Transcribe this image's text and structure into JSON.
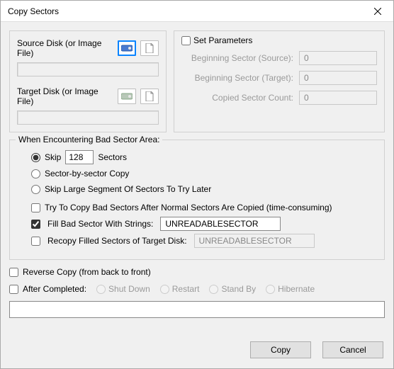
{
  "title": "Copy Sectors",
  "left": {
    "source_label": "Source Disk (or Image File)",
    "target_label": "Target Disk (or Image File)"
  },
  "params": {
    "set_label": "Set Parameters",
    "beg_src_label": "Beginning Sector (Source):",
    "beg_src_value": "0",
    "beg_tgt_label": "Beginning Sector (Target):",
    "beg_tgt_value": "0",
    "count_label": "Copied Sector Count:",
    "count_value": "0"
  },
  "bad": {
    "legend": "When Encountering Bad Sector Area:",
    "skip_label": "Skip",
    "skip_value": "128",
    "skip_suffix": "Sectors",
    "sector_by_sector": "Sector-by-sector Copy",
    "skip_large": "Skip Large Segment Of Sectors To Try Later",
    "try_copy_bad": "Try To Copy Bad Sectors After Normal Sectors Are Copied (time-consuming)",
    "fill_label": "Fill Bad Sector With Strings:",
    "fill_value": "UNREADABLESECTOR",
    "recopy_label": "Recopy Filled Sectors of Target Disk:",
    "recopy_value": "UNREADABLESECTOR"
  },
  "reverse_label": "Reverse Copy (from back to front)",
  "after": {
    "label": "After Completed:",
    "shut": "Shut Down",
    "restart": "Restart",
    "standby": "Stand By",
    "hibernate": "Hibernate"
  },
  "buttons": {
    "copy": "Copy",
    "cancel": "Cancel"
  }
}
